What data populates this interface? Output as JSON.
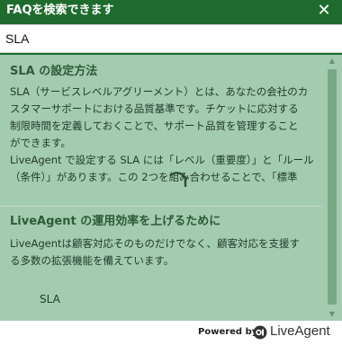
{
  "header": {
    "title": "FAQを検索できます",
    "close_icon": "close-icon"
  },
  "search": {
    "value": "SLA"
  },
  "results": [
    {
      "title": "SLA の設定方法",
      "lines": [
        "SLA（サービスレベルアグリーメント）とは、あなたの会社のカ",
        "スタマーサポートにおける品質基準です。チケットに応対する",
        "制限時間を定義しておくことで、サポート品質を管理すること",
        "ができます。",
        "LiveAgent で設定する SLA には「レベル（重要度）」と「ルール",
        "（条件）」があります。この 2つを組み合わせることで、「標準"
      ]
    },
    {
      "title": "LiveAgent の運用効率を上げるために",
      "lines": [
        "LiveAgentは顧客対応そのものだけでなく、顧客対応を支援す",
        "る多数の拡張機能を備えています。"
      ],
      "tag": "SLA"
    }
  ],
  "footer": {
    "powered_by": "Powered by",
    "brand": "LiveAgent"
  }
}
